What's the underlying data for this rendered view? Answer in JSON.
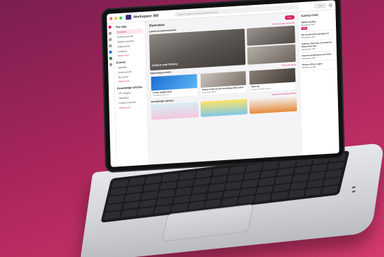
{
  "app": {
    "name": "Workspace 365",
    "search_placeholder": "Search for apps, documents, files and more...",
    "feedback_label": "Follow"
  },
  "colors": {
    "accent": "#d81b60",
    "brand": "#3a2a7a",
    "background": "#a8255c"
  },
  "sidebar": {
    "title": "The Hub",
    "items": [
      {
        "label": "Overview",
        "active": true
      },
      {
        "label": "Announcements"
      },
      {
        "label": "Weekly overview"
      },
      {
        "label": "Gallery items"
      },
      {
        "label": "Company"
      },
      {
        "label": "Show more",
        "link": true
      }
    ],
    "section2": "Events",
    "items2": [
      {
        "label": "Calendar"
      },
      {
        "label": "Event reports"
      },
      {
        "label": "My events"
      },
      {
        "label": "Show more",
        "link": true
      }
    ],
    "section3": "Knowledge articles",
    "items3": [
      {
        "label": "HR category"
      },
      {
        "label": "Handbook"
      },
      {
        "label": "Product overview"
      },
      {
        "label": "Show more",
        "link": true
      }
    ]
  },
  "main": {
    "title": "Overview",
    "new_label": "New",
    "announcements": {
      "label": "Latest announcements",
      "view_all": "View all announcements",
      "hero_caption": "Culture and history"
    },
    "events": {
      "label": "Upcoming events",
      "view_all": "View all events",
      "items": [
        {
          "title": "Lunch update 2024",
          "detail": "Conference Room 1"
        },
        {
          "title": "Please invite for all everything about asks",
          "detail": "Workspace Office"
        },
        {
          "title": "Meet Up",
          "detail": "Business Weekly Report"
        }
      ]
    },
    "knowledge": {
      "label": "Knowledge articles",
      "view_all": "View all knowledge articles",
      "items": [
        {
          "title": "Growing our culture"
        },
        {
          "title": "Code of Conduct"
        },
        {
          "title": "Change management"
        }
      ]
    }
  },
  "feed": {
    "title": "Activity Feed",
    "items": [
      {
        "title": "Update meeting",
        "meta": "Workspace 365",
        "action": "Join"
      },
      {
        "title": "We all attend the meetings for",
        "meta": "Workspace 365"
      },
      {
        "title": "Anthony Chan sent an invitation, Please fill it fast",
        "meta": "Workspace 365"
      },
      {
        "title": "Channel maintenance by Teams",
        "meta": "Workspace 365"
      },
      {
        "title": "Remote office is quiet",
        "meta": "Workspace 365"
      }
    ]
  }
}
